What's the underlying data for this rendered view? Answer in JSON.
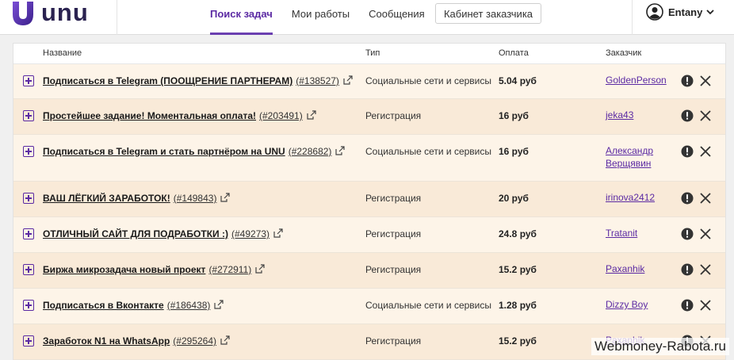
{
  "header": {
    "logo_text": "unu",
    "nav": [
      {
        "label": "Поиск задач",
        "active": true
      },
      {
        "label": "Мои работы",
        "active": false
      },
      {
        "label": "Сообщения",
        "active": false
      }
    ],
    "cabinet_button": "Кабинет заказчика",
    "user_name": "Entany"
  },
  "table": {
    "headers": {
      "name": "Название",
      "type": "Тип",
      "pay": "Оплата",
      "customer": "Заказчик"
    },
    "rows": [
      {
        "title": "Подписаться в Telegram (ПООЩРЕНИЕ ПАРТНЕРАМ)",
        "id": "(#138527)",
        "type": "Социальные сети и сервисы",
        "pay": "5.04 руб",
        "customer": "GoldenPerson"
      },
      {
        "title": "Простейшее задание! Моментальная оплата!",
        "id": "(#203491)",
        "type": "Регистрация",
        "pay": "16 руб",
        "customer": "jeka43"
      },
      {
        "title": "Подписаться в Telegram и стать партнёром на UNU",
        "id": "(#228682)",
        "type": "Социальные сети и сервисы",
        "pay": "16 руб",
        "customer": "Александр Верщявин"
      },
      {
        "title": "ВАШ ЛЁГКИЙ ЗАРАБОТОК!",
        "id": "(#149843)",
        "type": "Регистрация",
        "pay": "20 руб",
        "customer": "irinova2412"
      },
      {
        "title": "ОТЛИЧНЫЙ САЙТ ДЛЯ ПОДРАБОТКИ :)",
        "id": "(#49273)",
        "type": "Регистрация",
        "pay": "24.8 руб",
        "customer": "Tratanit"
      },
      {
        "title": "Биржа микрозадача новый проект",
        "id": "(#272911)",
        "type": "Регистрация",
        "pay": "15.2 руб",
        "customer": "Paxanhik"
      },
      {
        "title": "Подписаться в Вконтакте",
        "id": "(#186438)",
        "type": "Социальные сети и сервисы",
        "pay": "1.28 руб",
        "customer": "Dizzy Boy"
      },
      {
        "title": "Заработок N1 на WhatsApp",
        "id": "(#295264)",
        "type": "Регистрация",
        "pay": "15.2 руб",
        "customer": "Paxanhik"
      }
    ]
  },
  "watermark": "Webmoney-Rabota.ru",
  "colors": {
    "accent": "#5b2aa3",
    "row_light": "#fdf4e8",
    "row_dark": "#f9ead8"
  }
}
